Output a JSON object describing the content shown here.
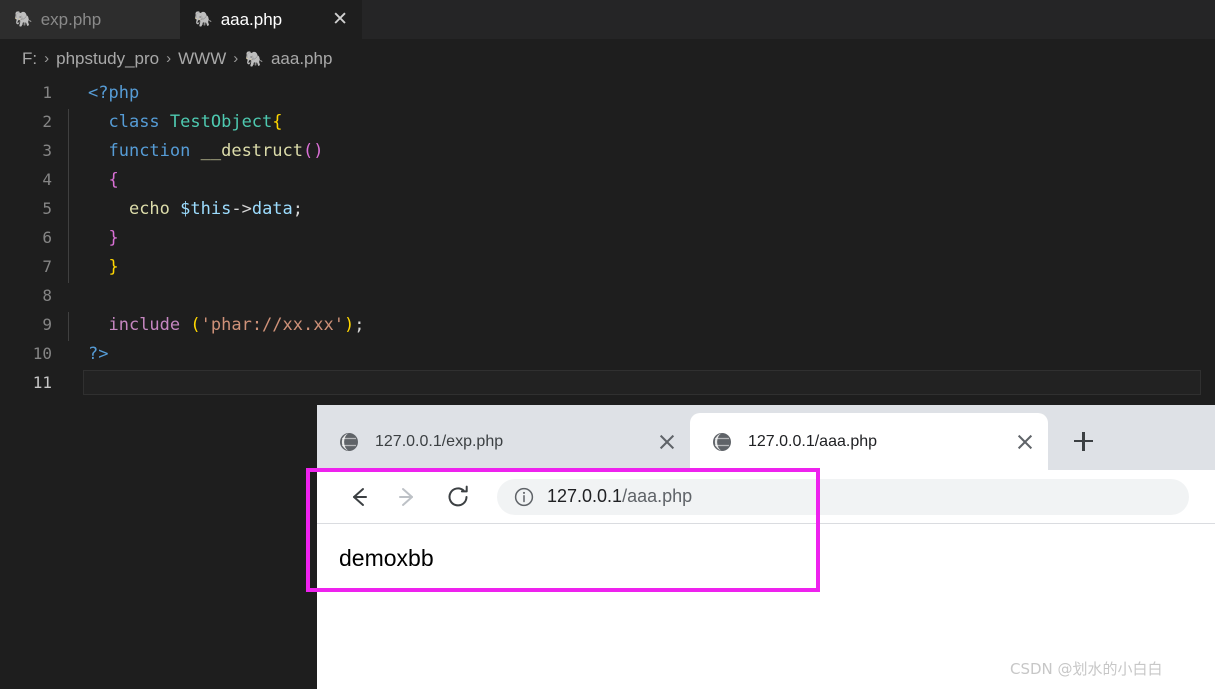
{
  "editor": {
    "tabs": [
      {
        "label": "exp.php",
        "icon": "php-elephant-icon",
        "active": false,
        "closable": false
      },
      {
        "label": "aaa.php",
        "icon": "php-elephant-icon",
        "active": true,
        "closable": true
      }
    ],
    "close_glyph": "✕",
    "breadcrumb": {
      "separator": "›",
      "items": [
        "F:",
        "phpstudy_pro",
        "WWW",
        "aaa.php"
      ],
      "file_icon": "php-elephant-icon"
    },
    "elephant_glyph": "🐘",
    "line_numbers": [
      "1",
      "2",
      "3",
      "4",
      "5",
      "6",
      "7",
      "8",
      "9",
      "10",
      "11"
    ],
    "code_lines": [
      {
        "n": "1",
        "text": "<?php"
      },
      {
        "n": "2",
        "text": "  class TestObject{"
      },
      {
        "n": "3",
        "text": "  function __destruct()"
      },
      {
        "n": "4",
        "text": "  {"
      },
      {
        "n": "5",
        "text": "    echo $this->data;"
      },
      {
        "n": "6",
        "text": "  }"
      },
      {
        "n": "7",
        "text": "  }"
      },
      {
        "n": "8",
        "text": ""
      },
      {
        "n": "9",
        "text": "  include ('phar://xx.xx');"
      },
      {
        "n": "10",
        "text": "?>"
      },
      {
        "n": "11",
        "text": ""
      }
    ],
    "tokens": {
      "php_open": "<?php",
      "php_close": "?>",
      "kw_class": "class",
      "class_name": "TestObject",
      "brace_open_class": "{",
      "kw_function": "function",
      "fn_name": "__destruct",
      "paren_open": "(",
      "paren_close": ")",
      "brace_open_fn": "{",
      "kw_echo": "echo",
      "var_this": "$this",
      "arrow": "->",
      "prop_data": "data",
      "semicolon": ";",
      "brace_close_fn": "}",
      "brace_close_class": "}",
      "kw_include": "include",
      "space": " ",
      "inc_paren_open": "(",
      "inc_string": "'phar://xx.xx'",
      "inc_paren_close": ")",
      "inc_semicolon": ";",
      "indent1": "  ",
      "indent2": "    "
    },
    "current_line": "11"
  },
  "browser": {
    "tabs": [
      {
        "title": "127.0.0.1/exp.php",
        "active": false,
        "favicon": "globe-icon"
      },
      {
        "title": "127.0.0.1/aaa.php",
        "active": true,
        "favicon": "globe-icon"
      }
    ],
    "new_tab_label": "+",
    "toolbar": {
      "back_icon": "back-arrow-icon",
      "forward_icon": "forward-arrow-icon",
      "reload_icon": "reload-icon",
      "site_info_icon": "info-circle-icon",
      "url_host": "127.0.0.1",
      "url_path": "/aaa.php"
    },
    "content": {
      "body_text": "demoxbb"
    }
  },
  "annotation": {
    "color": "#ee22ee",
    "label": "highlight-box"
  },
  "watermark": {
    "text": "CSDN @划水的小白白"
  }
}
